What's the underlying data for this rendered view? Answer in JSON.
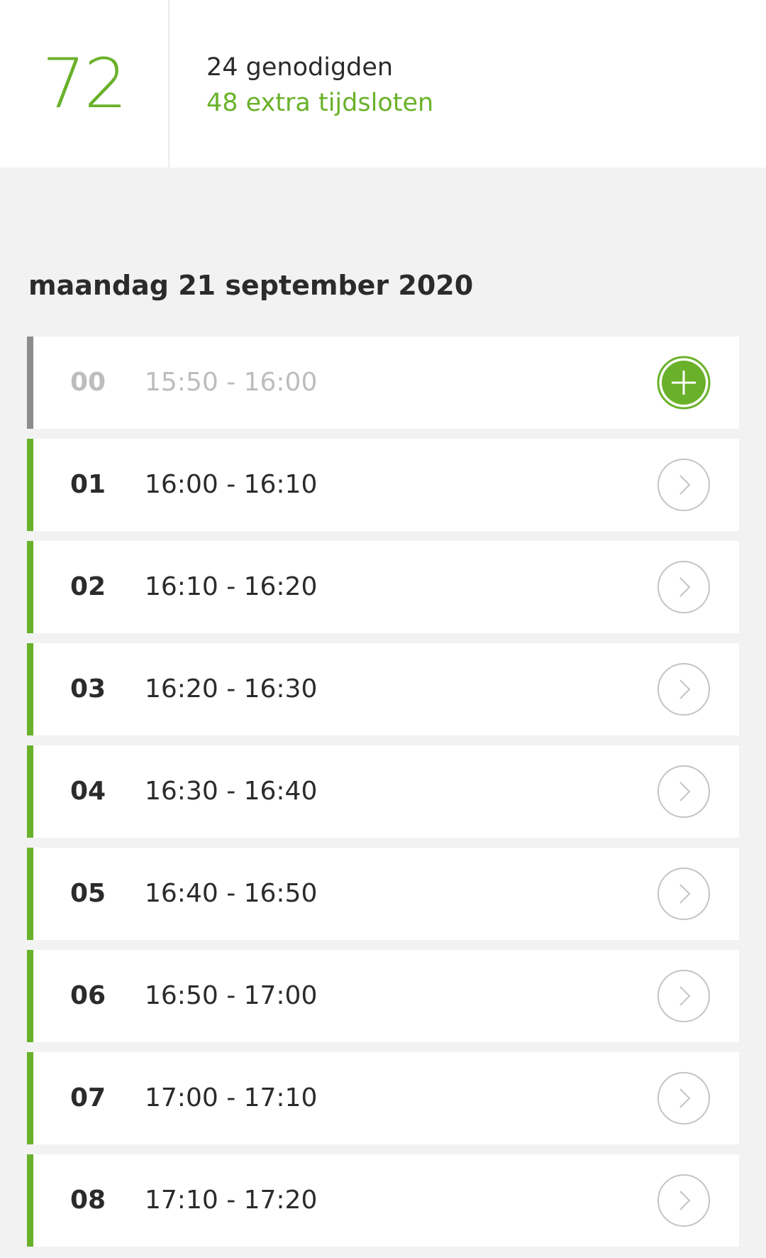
{
  "summary": {
    "total": "72",
    "invitees": "24 genodigden",
    "extra_slots": "48 extra tijdsloten"
  },
  "day": {
    "title": "maandag 21 september 2020"
  },
  "slots": [
    {
      "number": "00",
      "time": "15:50 - 16:00",
      "action": "plus-icon",
      "state": "inactive"
    },
    {
      "number": "01",
      "time": "16:00 - 16:10",
      "action": "chevron-right-icon",
      "state": "active"
    },
    {
      "number": "02",
      "time": "16:10 - 16:20",
      "action": "chevron-right-icon",
      "state": "active"
    },
    {
      "number": "03",
      "time": "16:20 - 16:30",
      "action": "chevron-right-icon",
      "state": "active"
    },
    {
      "number": "04",
      "time": "16:30 - 16:40",
      "action": "chevron-right-icon",
      "state": "active"
    },
    {
      "number": "05",
      "time": "16:40 - 16:50",
      "action": "chevron-right-icon",
      "state": "active"
    },
    {
      "number": "06",
      "time": "16:50 - 17:00",
      "action": "chevron-right-icon",
      "state": "active"
    },
    {
      "number": "07",
      "time": "17:00 - 17:10",
      "action": "chevron-right-icon",
      "state": "active"
    },
    {
      "number": "08",
      "time": "17:10 - 17:20",
      "action": "chevron-right-icon",
      "state": "active"
    }
  ],
  "colors": {
    "accent": "#6ab12a",
    "inactive_bar": "#8c8c8c",
    "inactive_text": "#bdbdbd",
    "text": "#2b2b2b",
    "background": "#f2f2f2"
  }
}
